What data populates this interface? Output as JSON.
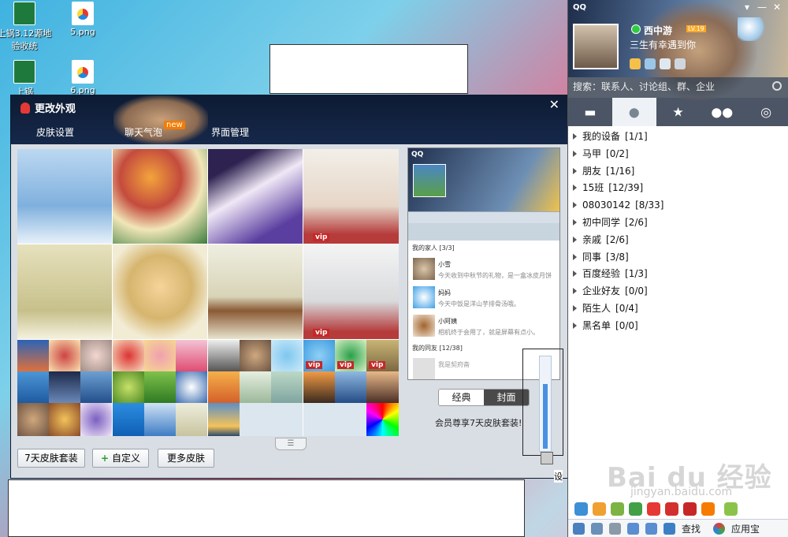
{
  "desktop": {
    "icons": [
      {
        "label": "上锅3.12源地验收统",
        "type": "xls"
      },
      {
        "label": "5.png",
        "type": "png"
      },
      {
        "label": "上锅",
        "type": "xls"
      },
      {
        "label": "6.png",
        "type": "png"
      }
    ]
  },
  "skin_dialog": {
    "title": "更改外观",
    "close": "✕",
    "tabs": [
      "皮肤设置",
      "聊天气泡",
      "界面管理"
    ],
    "new_badge": "new",
    "vip_label": "vip",
    "handle": "☰",
    "preview": {
      "app_name": "QQ",
      "group1": "我的家人 [3/3]",
      "contacts": [
        {
          "name": "小雪",
          "signature": "今天收到中秋节的礼物，是一盒冰皮月饼"
        },
        {
          "name": "妈妈",
          "signature": "今天中饭是洋山芋排骨汤哦。"
        },
        {
          "name": "小阿姨",
          "signature": "相机终于会用了，就是屏幕有点小。"
        }
      ],
      "group2": "我的同友 [12/38]",
      "faded_contact": "我是契府斋"
    },
    "mode_toggle": {
      "classic": "经典",
      "cover": "封面"
    },
    "member_text": "会员尊享7天皮肤套装!",
    "buttons": {
      "seven_day": "7天皮肤套装",
      "custom": "自定义",
      "more": "更多皮肤"
    },
    "custom_plus": "+",
    "transparency_fraction": 0.72
  },
  "side_label": "设",
  "qq_panel": {
    "app_name": "QQ",
    "window_buttons": [
      "▾",
      "—",
      "✕"
    ],
    "nickname": "西中游",
    "level": "LV.19",
    "signature": "三生有幸遇到你",
    "search_placeholder": "搜索：联系人、讨论组、群、企业",
    "groups": [
      {
        "name": "我的设备",
        "count": "[1/1]"
      },
      {
        "name": "马甲",
        "count": "[0/2]"
      },
      {
        "name": "朋友",
        "count": "[1/16]"
      },
      {
        "name": "15班",
        "count": "[12/39]"
      },
      {
        "name": "08030142",
        "count": "[8/33]"
      },
      {
        "name": "初中同学",
        "count": "[2/6]"
      },
      {
        "name": "亲戚",
        "count": "[2/6]"
      },
      {
        "name": "同事",
        "count": "[3/8]"
      },
      {
        "name": "百度经验",
        "count": "[1/3]"
      },
      {
        "name": "企业好友",
        "count": "[0/0]"
      },
      {
        "name": "陌生人",
        "count": "[0/4]"
      },
      {
        "name": "黑名单",
        "count": "[0/0]"
      }
    ],
    "bottom": {
      "find_label": "查找",
      "app_store_label": "应用宝"
    }
  },
  "watermark": {
    "main": "Bai du 经验",
    "sub": "jingyan.baidu.com"
  },
  "colors": {
    "qq_tab_bar": "#4c5565",
    "dialog_header": "#0d1b33",
    "vip_red": "#c62828",
    "new_orange": "#f57c00"
  }
}
